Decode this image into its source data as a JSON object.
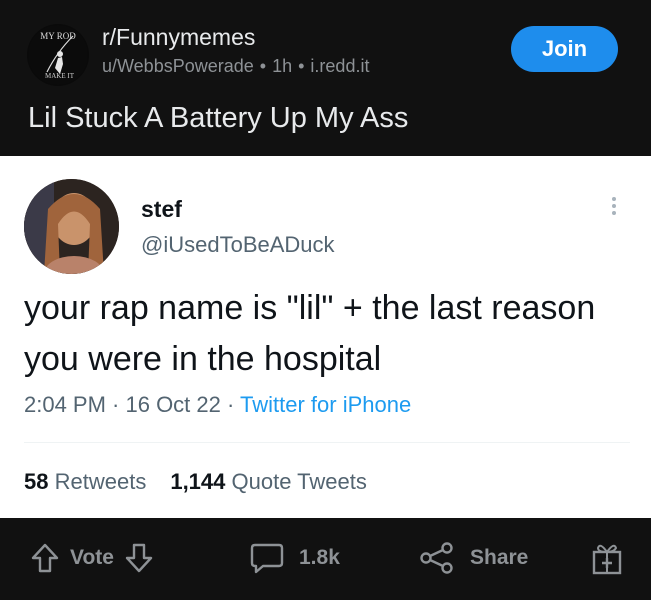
{
  "header": {
    "subreddit": "r/Funnymemes",
    "user": "u/WebbsPowerade",
    "age": "1h",
    "domain": "i.redd.it",
    "join_label": "Join",
    "title": "Lil Stuck A Battery Up My Ass",
    "avatar_top_text": "MY ROD",
    "avatar_bottom_text": "MAKE IT"
  },
  "tweet": {
    "name": "stef",
    "handle": "@iUsedToBeADuck",
    "text": "your rap name is \"lil\" + the last reason you were in the hospital",
    "time": "2:04 PM · 16 Oct 22 · ",
    "source": "Twitter for iPhone",
    "retweets_count": "58",
    "retweets_label": "Retweets",
    "quotes_count": "1,144",
    "quotes_label": "Quote Tweets"
  },
  "actions": {
    "vote_label": "Vote",
    "comments_count": "1.8k",
    "share_label": "Share"
  },
  "colors": {
    "background": "#101010",
    "join_button": "#1e8ded",
    "twitter_blue": "#1d9bf0",
    "muted_text": "#8e9296"
  }
}
